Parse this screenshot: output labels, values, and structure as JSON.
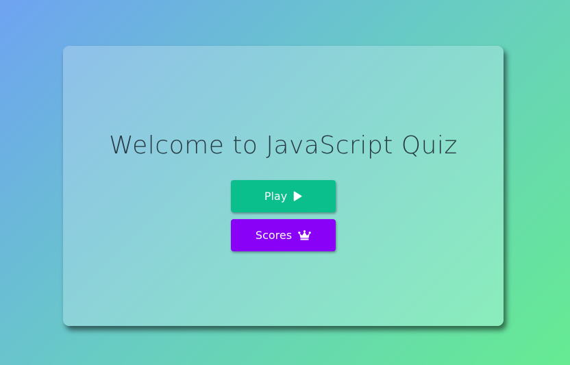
{
  "welcome": {
    "title": "Welcome to JavaScript Quiz"
  },
  "buttons": {
    "play_label": "Play",
    "play_icon": "play-icon",
    "scores_label": "Scores",
    "scores_icon": "crown-icon"
  },
  "colors": {
    "play_button": "#0bbf8d",
    "scores_button": "#8902f7",
    "title_text": "#273a44"
  }
}
